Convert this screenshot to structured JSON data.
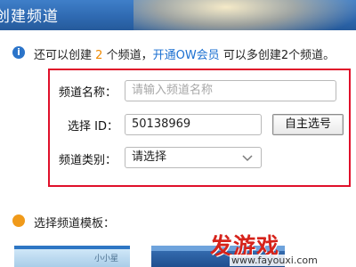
{
  "window": {
    "title": "创建频道"
  },
  "notice": {
    "prefix": "还可以创建",
    "count": "2",
    "middle": "个频道，",
    "vip_link": "开通OW会员",
    "suffix": "可以多创建2个频道。"
  },
  "form": {
    "name_label": "频道名称：",
    "name_placeholder": "请输入频道名称",
    "id_label": "选择 ID：",
    "id_value": "50138969",
    "custom_id_button": "自主选号",
    "category_label": "频道类别：",
    "category_value": "请选择"
  },
  "templates": {
    "label": "选择频道模板：",
    "thumb1_text": "小小星"
  },
  "watermark": {
    "text": "发游戏",
    "url": "www.fayouxi.com"
  },
  "colors": {
    "highlight_border": "#e0102a",
    "count": "#f08a00",
    "link": "#1a6fd1",
    "watermark": "#d6231b"
  }
}
